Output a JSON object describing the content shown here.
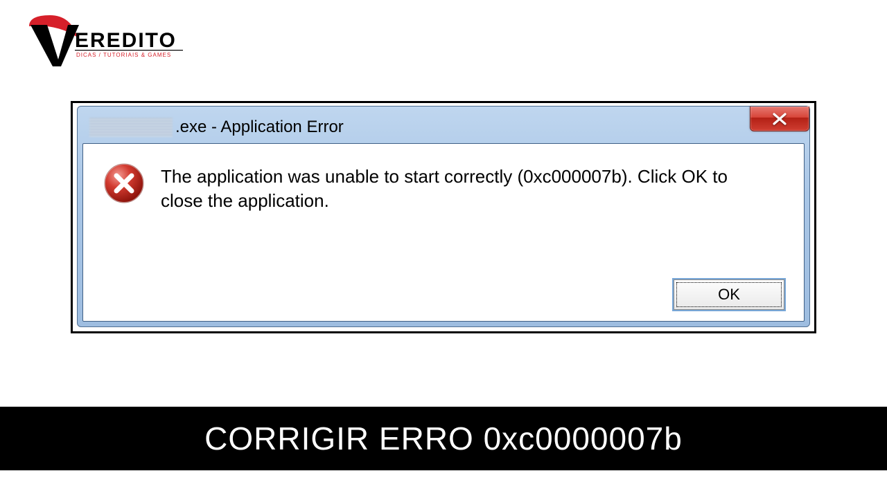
{
  "logo": {
    "brand": "EREDITO",
    "tagline": "DICAS / TUTORIAIS & GAMES"
  },
  "dialog": {
    "title_suffix": ".exe - Application Error",
    "message": "The application was unable to start correctly (0xc000007b). Click OK to close the application.",
    "close_char": "X",
    "ok_label": "OK"
  },
  "caption": "CORRIGIR ERRO 0xc0000007b"
}
